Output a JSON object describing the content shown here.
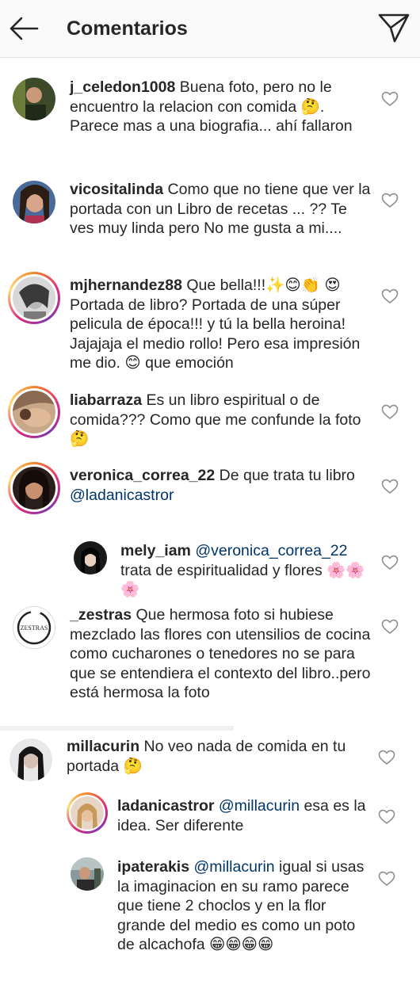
{
  "header": {
    "title": "Comentarios",
    "back_icon": "arrow-left-icon",
    "share_icon": "paper-plane-icon"
  },
  "comments": [
    {
      "username": "j_celedon1008",
      "text": " Buena foto, pero no le encuentro la relacion con comida 🤔. Parece mas a una biografia... ahí fallaron"
    },
    {
      "username": "vicositalinda",
      "text": " Como que no tiene que ver la portada con un Libro de recetas ... ?? Te ves muy linda pero No me gusta a mi...."
    },
    {
      "username": "mjhernandez88",
      "text_a": " Que bella!!!✨😊👏 ",
      "text_b": "😍Portada de libro? Portada de una súper pelicula de época!!! y tú la bella heroina! Jajajaja el medio rollo! Pero esa impresión me dio. 😊 que emoción"
    },
    {
      "username": "liabarraza",
      "text": " Es un libro espiritual o de comida??? Como que me confunde la foto 🤔"
    },
    {
      "username": "veronica_correa_22",
      "text": " De que trata tu libro ",
      "mention": "@ladanicastror"
    },
    {
      "username": "mely_iam",
      "mention": " @veronica_correa_22",
      "text": " trata de espiritualidad y flores 🌸🌸🌸"
    },
    {
      "username": "_zestras",
      "text": " Que hermosa foto si hubiese mezclado las flores con utensilios de cocina como cucharones o tenedores no se para que se entendiera el contexto del libro..pero está hermosa la foto",
      "avatar_text": "ZESTRAS"
    },
    {
      "username": "millacurin",
      "text": " No veo nada de comida en tu portada 🤔"
    },
    {
      "username": "ladanicastror",
      "mention": " @millacurin",
      "text": " esa es la idea. Ser diferente"
    },
    {
      "username": "ipaterakis",
      "mention": " @millacurin",
      "text": " igual si usas la imaginacion en su ramo parece que tiene 2 choclos y en la flor grande del medio es como un poto de alcachofa 😁😁😁😁"
    }
  ],
  "colors": {
    "mention": "#003569",
    "text": "#262626",
    "header_bg": "#fafafa"
  }
}
